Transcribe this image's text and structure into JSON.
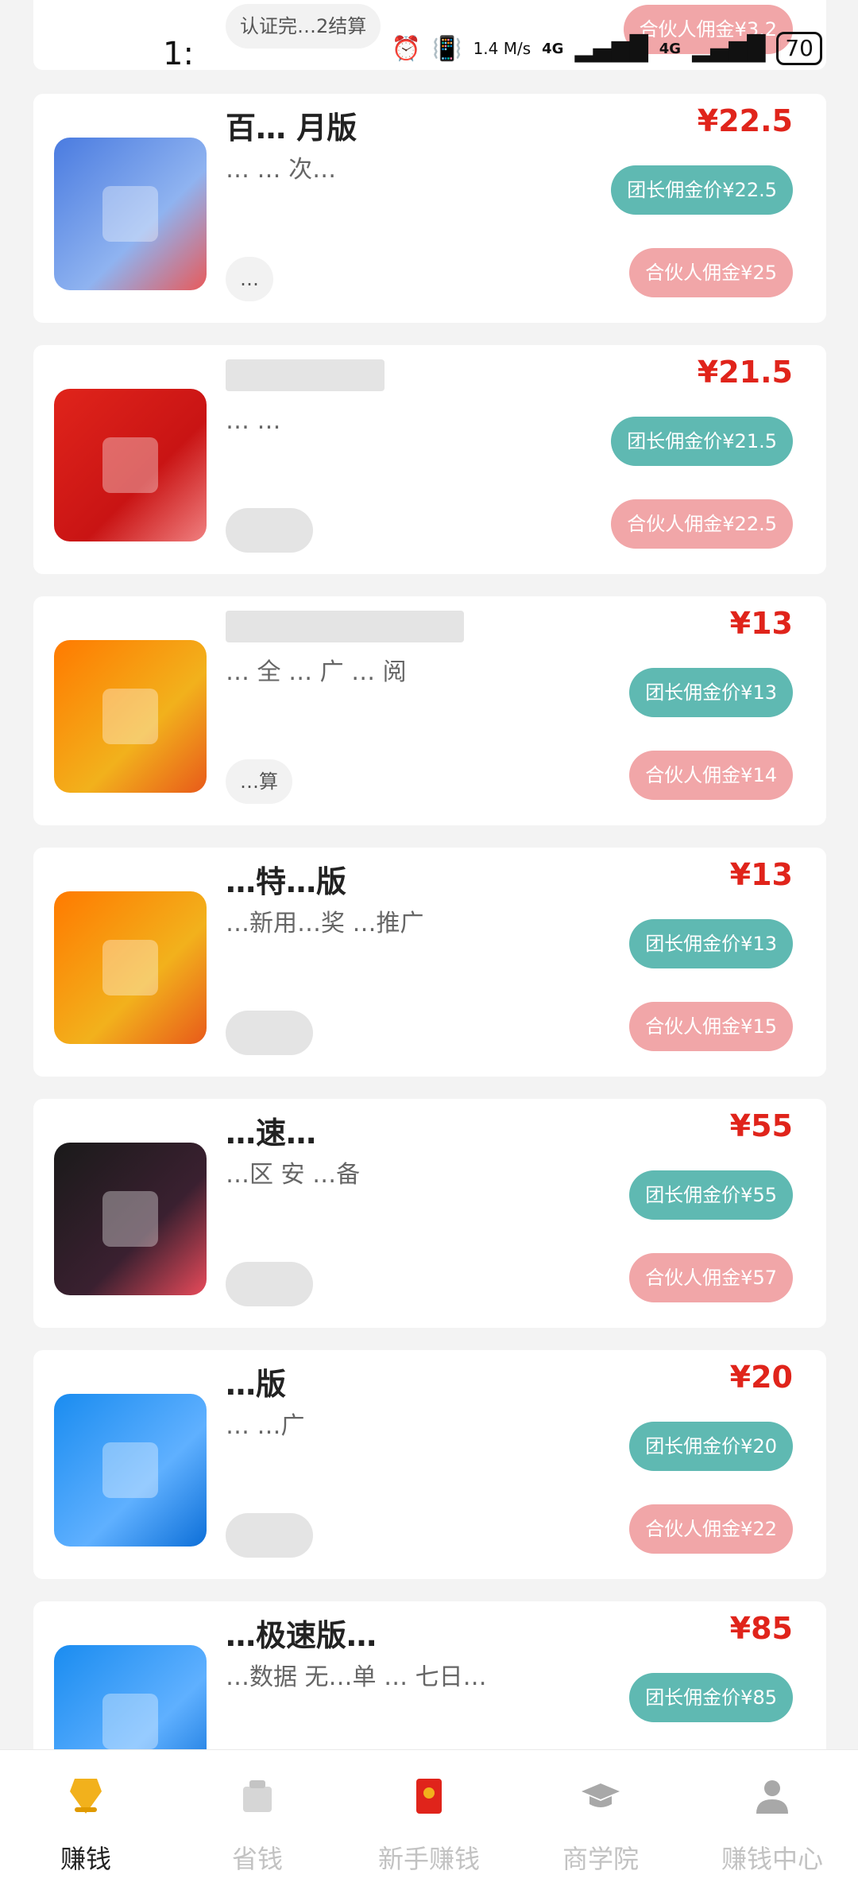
{
  "status_bar": {
    "time": "1:",
    "net_speed": "1.4 M/s",
    "sig1": "4G",
    "sig2": "4G",
    "battery": "70"
  },
  "top_partial": {
    "tag": "认证完…2结算",
    "partner": "合伙人佣金¥3.2"
  },
  "cards": [
    {
      "title": "百… 月版",
      "desc": "… … 次…",
      "tag": "…",
      "price": "¥22.5",
      "leader": "团长佣金价¥22.5",
      "partner": "合伙人佣金¥25"
    },
    {
      "title": "",
      "desc": "… …",
      "tag": "",
      "price": "¥21.5",
      "leader": "团长佣金价¥21.5",
      "partner": "合伙人佣金¥22.5"
    },
    {
      "title": "",
      "desc": "… 全 … 广 … 阅",
      "tag": "…算",
      "price": "¥13",
      "leader": "团长佣金价¥13",
      "partner": "合伙人佣金¥14"
    },
    {
      "title": "…特…版",
      "desc": "…新用…奖 …推广",
      "tag": "",
      "price": "¥13",
      "leader": "团长佣金价¥13",
      "partner": "合伙人佣金¥15"
    },
    {
      "title": "…速…",
      "desc": "…区 安 …备",
      "tag": "",
      "price": "¥55",
      "leader": "团长佣金价¥55",
      "partner": "合伙人佣金¥57"
    },
    {
      "title": "…版",
      "desc": "… …广",
      "tag": "",
      "price": "¥20",
      "leader": "团长佣金价¥20",
      "partner": "合伙人佣金¥22"
    },
    {
      "title": "…极速版…",
      "desc": "…数据 无…单 … 七日…",
      "tag": "",
      "price": "¥85",
      "leader": "团长佣金价¥85",
      "partner": ""
    }
  ],
  "bottom_nav": [
    {
      "label": "赚钱",
      "icon": "earn-icon"
    },
    {
      "label": "省钱",
      "icon": "save-icon"
    },
    {
      "label": "新手赚钱",
      "icon": "red-envelope-icon"
    },
    {
      "label": "商学院",
      "icon": "graduation-cap-icon"
    },
    {
      "label": "赚钱中心",
      "icon": "user-icon"
    }
  ],
  "colors": {
    "price": "#e0241b",
    "leader_pill": "#5fb9b2",
    "partner_pill": "#f1a6a8",
    "active_icon": "#f2b11c"
  }
}
